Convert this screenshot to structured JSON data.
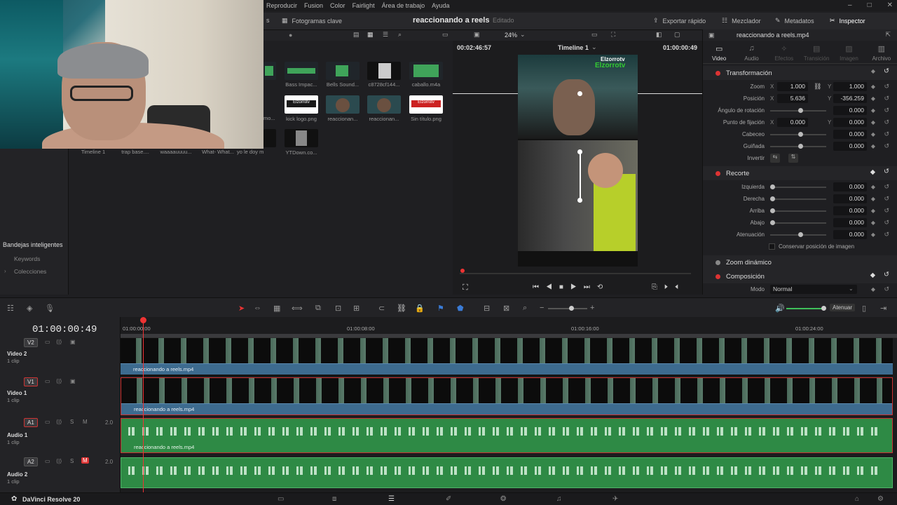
{
  "menu": {
    "items": [
      "Reproducir",
      "Fusion",
      "Color",
      "Fairlight",
      "Área de trabajo",
      "Ayuda"
    ],
    "window_controls": [
      "–",
      "□",
      "✕"
    ]
  },
  "toolbar": {
    "fotogramas_label": "Fotogramas clave",
    "project_title": "reaccionando a reels",
    "edited_label": "Editado",
    "export_label": "Exportar rápido",
    "mixer_label": "Mezclador",
    "metadata_label": "Metadatos",
    "inspector_label": "Inspector"
  },
  "viewer": {
    "zoom": "24%",
    "tc_left": "00:02:46:57",
    "timeline_name": "Timeline 1",
    "tc_right": "01:00:00:49",
    "watermark_top": "Elzorrotv",
    "watermark_green": "Elzorrotv"
  },
  "media_pool": {
    "clips": [
      {
        "label": "Bass Impac...",
        "kind": "wave"
      },
      {
        "label": "Bells Sound...",
        "kind": "wave"
      },
      {
        "label": "c8728cf144...",
        "kind": "image"
      },
      {
        "label": "caballo.m4a",
        "kind": "wave"
      },
      {
        "label": "kick logo.png",
        "kind": "logo"
      },
      {
        "label": "reaccionan...",
        "kind": "video"
      },
      {
        "label": "reaccionan...",
        "kind": "video"
      },
      {
        "label": "Sin título.png",
        "kind": "logo"
      },
      {
        "label": "YTDown.co...",
        "kind": "image"
      }
    ],
    "row3_labels": [
      "Timeline 1",
      "trap base....",
      "waaaauuuu...",
      "What- What...",
      "yo le doy m..."
    ],
    "partial_label": "mo...",
    "logo_text": "Elzorrotv"
  },
  "smart_bins": {
    "title": "Bandejas inteligentes",
    "items": [
      "Keywords",
      "Colecciones"
    ]
  },
  "inspector": {
    "clip_name": "reaccionando a reels.mp4",
    "tabs": [
      {
        "label": "Video",
        "icon": "video-icon",
        "active": true
      },
      {
        "label": "Audio",
        "icon": "music-icon",
        "active": false
      },
      {
        "label": "Efectos",
        "icon": "effects-icon",
        "active": false
      },
      {
        "label": "Transición",
        "icon": "transition-icon",
        "active": false
      },
      {
        "label": "Imagen",
        "icon": "image-icon",
        "active": false
      },
      {
        "label": "Archivo",
        "icon": "file-icon",
        "active": false
      }
    ],
    "transform": {
      "title": "Transformación",
      "zoom_label": "Zoom",
      "zoom_x": "1.000",
      "zoom_y": "1.000",
      "position_label": "Posición",
      "pos_x": "5.636",
      "pos_y": "-356.259",
      "rotation_label": "Ángulo de rotación",
      "rotation": "0.000",
      "anchor_label": "Punto de fijación",
      "anchor_x": "0.000",
      "anchor_y": "0.000",
      "pitch_label": "Cabeceo",
      "pitch": "0.000",
      "yaw_label": "Guiñada",
      "yaw": "0.000",
      "flip_label": "Invertir"
    },
    "crop": {
      "title": "Recorte",
      "left_label": "Izquierda",
      "left": "0.000",
      "right_label": "Derecha",
      "right": "0.000",
      "top_label": "Arriba",
      "top": "0.000",
      "bottom_label": "Abajo",
      "bottom": "0.000",
      "softness_label": "Atenuación",
      "softness": "0.000",
      "retain_label": "Conservar posición de imagen"
    },
    "dynamic_zoom_title": "Zoom dinámico",
    "composite": {
      "title": "Composición",
      "mode_label": "Modo",
      "mode_value": "Normal"
    },
    "axis_x": "X",
    "axis_y": "Y"
  },
  "timeline": {
    "timecode": "01:00:00:49",
    "ruler_labels": [
      "01:00:00:00",
      "01:00:08:00",
      "01:00:16:00",
      "01:00:24:00"
    ],
    "attenuate_label": "Atenuar",
    "clip_count": "1 clip",
    "tracks": [
      {
        "badge": "V2",
        "name": "Video 2",
        "clip": "reaccionando a reels.mp4",
        "type": "video"
      },
      {
        "badge": "V1",
        "name": "Video 1",
        "clip": "reaccionando a reels.mp4",
        "type": "video"
      },
      {
        "badge": "A1",
        "name": "Audio 1",
        "clip": "reaccionando a reels.mp4",
        "type": "audio",
        "level": "2.0"
      },
      {
        "badge": "A2",
        "name": "Audio 2",
        "clip": "",
        "type": "audio",
        "level": "2.0"
      }
    ]
  },
  "status": {
    "app_name": "DaVinci Resolve 20"
  },
  "colors": {
    "accent_red": "#e33333",
    "video_clip": "#3d6b8f",
    "audio_clip": "#2e8a45"
  }
}
